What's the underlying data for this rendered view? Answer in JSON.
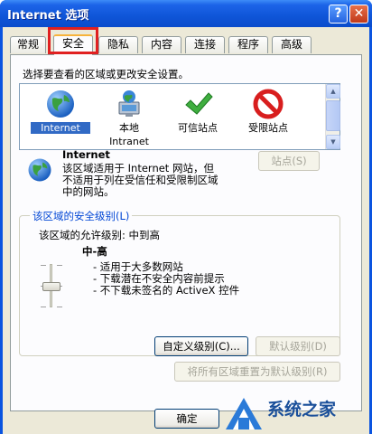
{
  "window": {
    "title": "Internet 选项"
  },
  "titlebar": {
    "help": "?",
    "close": "✕"
  },
  "tabs": [
    {
      "label": "常规",
      "active": false
    },
    {
      "label": "安全",
      "active": true
    },
    {
      "label": "隐私",
      "active": false
    },
    {
      "label": "内容",
      "active": false
    },
    {
      "label": "连接",
      "active": false
    },
    {
      "label": "程序",
      "active": false
    },
    {
      "label": "高级",
      "active": false
    }
  ],
  "security": {
    "instruction": "选择要查看的区域或更改安全设置。",
    "zones": [
      {
        "label": "Internet",
        "label2": "",
        "icon": "globe-icon",
        "selected": true
      },
      {
        "label": "本地",
        "label2": "Intranet",
        "icon": "intranet-icon",
        "selected": false
      },
      {
        "label": "可信站点",
        "label2": "",
        "icon": "checkmark-icon",
        "selected": false
      },
      {
        "label": "受限站点",
        "label2": "",
        "icon": "restricted-icon",
        "selected": false
      }
    ],
    "zone_info": {
      "name": "Internet",
      "desc1": "该区域适用于 Internet 网站，但",
      "desc2": "不适用于列在受信任和受限制区域",
      "desc3": "中的网站。"
    },
    "sites_button": "站点(S)",
    "level_group_title": "该区域的安全级别(L)",
    "allowed_levels": "该区域的允许级别: 中到高",
    "level_name": "中-高",
    "bullets": [
      "- 适用于大多数网站",
      "- 下载潜在不安全内容前提示",
      "- 不下载未签名的 ActiveX 控件"
    ],
    "custom_level_button": "自定义级别(C)...",
    "default_level_button": "默认级别(D)",
    "reset_all_button": "将所有区域重置为默认级别(R)"
  },
  "footer": {
    "ok_button": "确定"
  },
  "watermark": {
    "text": "系统之家"
  },
  "colors": {
    "titlebar": "#0a54e0",
    "tab_highlight": "#e02020",
    "selection": "#316ac5",
    "group_title": "#0046d5"
  }
}
